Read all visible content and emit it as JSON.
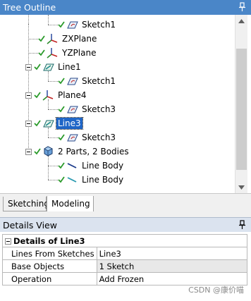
{
  "tree_panel": {
    "title": "Tree Outline"
  },
  "tree": {
    "nodes": [
      {
        "label": "Sketch1",
        "icon": "sketch-icon"
      },
      {
        "label": "ZXPlane",
        "icon": "plane-axes-icon"
      },
      {
        "label": "YZPlane",
        "icon": "plane-axes-icon"
      },
      {
        "label": "Line1",
        "icon": "line-feature-icon"
      },
      {
        "label": "Sketch1",
        "icon": "sketch-icon"
      },
      {
        "label": "Plane4",
        "icon": "plane-axes-icon"
      },
      {
        "label": "Sketch3",
        "icon": "sketch-icon"
      },
      {
        "label": "Line3",
        "icon": "line-feature-icon"
      },
      {
        "label": "Sketch3",
        "icon": "sketch-icon"
      },
      {
        "label": "2 Parts, 2 Bodies",
        "icon": "parts-bodies-icon"
      },
      {
        "label": "Line Body",
        "icon": "line-body-icon"
      },
      {
        "label": "Line Body",
        "icon": "line-body-icon"
      }
    ]
  },
  "tabs": {
    "sketching": "Sketching",
    "modeling": "Modeling"
  },
  "details_panel": {
    "title": "Details View"
  },
  "details": {
    "group": "Details of Line3",
    "rows": [
      {
        "name": "Lines From Sketches",
        "value": "Line3"
      },
      {
        "name": "Base Objects",
        "value": "1 Sketch"
      },
      {
        "name": "Operation",
        "value": "Add Frozen"
      }
    ]
  },
  "watermark": "CSDN @康价喵",
  "colors": {
    "header_blue": "#4a86c8",
    "selection_blue": "#1f66c7",
    "check_green": "#2a9a2a"
  }
}
